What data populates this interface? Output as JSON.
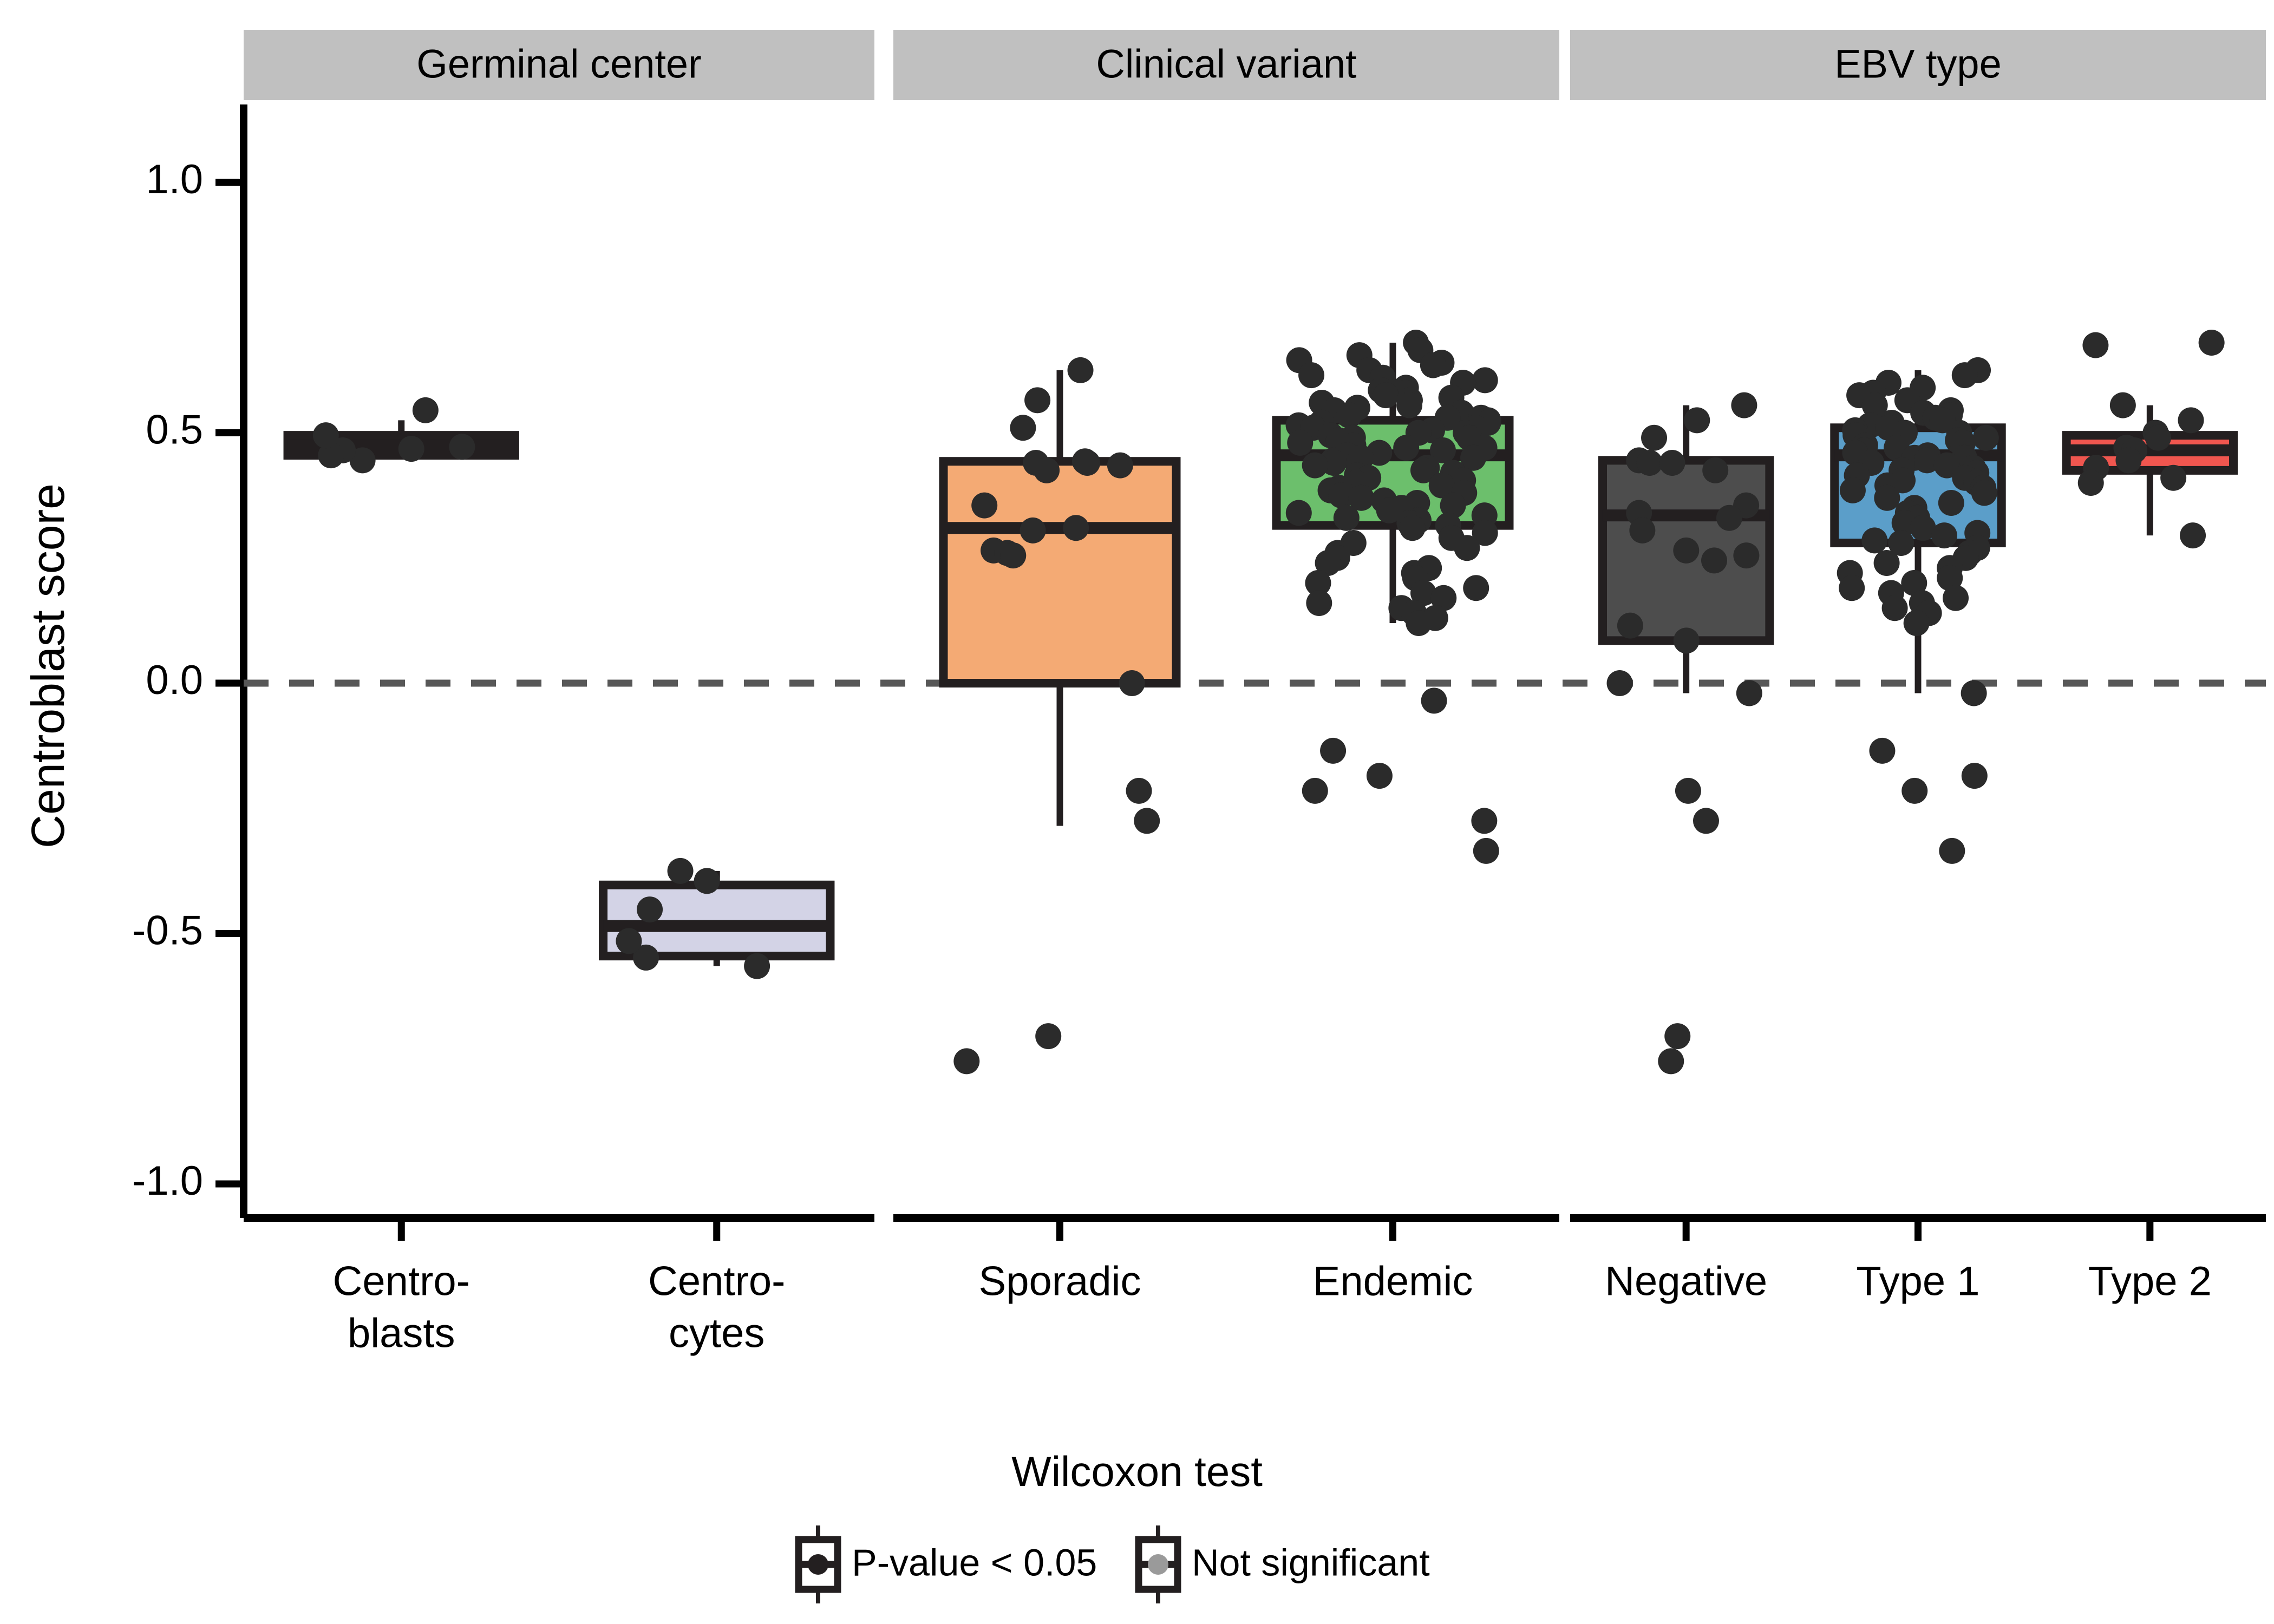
{
  "figure": {
    "ylabel": "Centroblast score",
    "y_ticks": [
      "1.0",
      "0.5",
      "0.0",
      "-0.5",
      "-1.0"
    ],
    "panels": [
      {
        "title": "Germinal center",
        "categories": [
          "Centro-\nblasts",
          "Centro-\ncytes"
        ]
      },
      {
        "title": "Clinical variant",
        "categories": [
          "Sporadic",
          "Endemic"
        ]
      },
      {
        "title": "EBV type",
        "categories": [
          "Negative",
          "Type 1",
          "Type 2"
        ]
      }
    ]
  },
  "legend": {
    "title": "Wilcoxon test",
    "items": [
      {
        "label": "P-value < 0.05",
        "box_fill": "#ffffff",
        "box_stroke": "#231f20",
        "dot": "#231f20"
      },
      {
        "label": "Not significant",
        "box_fill": "#ffffff",
        "box_stroke": "#231f20",
        "dot": "#9a9a9a"
      }
    ]
  },
  "colors": {
    "strip_bg": "#c0c0c0",
    "axis": "#000000",
    "point": "#2b2b2b",
    "zero_line": "#575757",
    "centroblasts": "#9a93c7",
    "centrocytes": "#d3d3e6",
    "sporadic": "#f4aa74",
    "endemic": "#6cbf6c",
    "negative": "#4d4d4d",
    "type1": "#5b9ec9",
    "type2": "#f0564f"
  },
  "chart_data": {
    "type": "box",
    "title": "",
    "ylabel": "Centroblast score",
    "xlabel": "",
    "ylim": [
      -1.18,
      1.12
    ],
    "yticks": [
      1.0,
      0.5,
      0.0,
      -0.5,
      -1.0
    ],
    "grid": false,
    "zero_reference_line": 0.0,
    "legend_position": "bottom",
    "facets": [
      {
        "name": "Germinal center",
        "groups": [
          {
            "label": "Centro-\nblasts",
            "fill": "#9a93c7",
            "significance": "P-value < 0.05",
            "box": {
              "q1": 0.455,
              "median": 0.475,
              "q3": 0.495,
              "lower_whisker": 0.455,
              "upper_whisker": 0.525
            },
            "points": [
              0.445,
              0.465,
              0.455,
              0.545,
              0.495,
              0.472,
              0.468
            ]
          },
          {
            "label": "Centro-\ncytes",
            "fill": "#d3d3e6",
            "significance": "P-value < 0.05",
            "box": {
              "q1": -0.545,
              "median": -0.485,
              "q3": -0.403,
              "lower_whisker": -0.565,
              "upper_whisker": -0.375
            },
            "points": [
              -0.375,
              -0.395,
              -0.452,
              -0.548,
              -0.565,
              -0.515
            ]
          }
        ]
      },
      {
        "name": "Clinical variant",
        "groups": [
          {
            "label": "Sporadic",
            "fill": "#f4aa74",
            "significance": "P-value < 0.05",
            "box": {
              "q1": 0.0,
              "median": 0.31,
              "q3": 0.443,
              "lower_whisker": -0.285,
              "upper_whisker": 0.625
            },
            "points": [
              0.625,
              0.565,
              0.51,
              0.443,
              0.435,
              0.44,
              0.44,
              0.425,
              0.355,
              0.31,
              0.305,
              0.265,
              0.26,
              0.255,
              0.0,
              -0.215,
              -0.275,
              -0.705,
              -0.755
            ]
          },
          {
            "label": "Endemic",
            "fill": "#6cbf6c",
            "significance": "P-value < 0.05",
            "box": {
              "q1": 0.315,
              "median": 0.455,
              "q3": 0.525,
              "lower_whisker": 0.12,
              "upper_whisker": 0.68
            },
            "points": [
              0.68,
              0.665,
              0.655,
              0.645,
              0.64,
              0.635,
              0.625,
              0.615,
              0.61,
              0.605,
              0.6,
              0.59,
              0.585,
              0.58,
              0.575,
              0.57,
              0.565,
              0.56,
              0.555,
              0.55,
              0.545,
              0.54,
              0.535,
              0.53,
              0.53,
              0.525,
              0.52,
              0.52,
              0.515,
              0.51,
              0.51,
              0.505,
              0.5,
              0.5,
              0.495,
              0.49,
              0.49,
              0.485,
              0.48,
              0.475,
              0.47,
              0.47,
              0.465,
              0.46,
              0.455,
              0.45,
              0.45,
              0.445,
              0.44,
              0.435,
              0.43,
              0.425,
              0.42,
              0.415,
              0.41,
              0.405,
              0.4,
              0.395,
              0.39,
              0.385,
              0.38,
              0.375,
              0.37,
              0.365,
              0.36,
              0.355,
              0.35,
              0.345,
              0.34,
              0.335,
              0.33,
              0.325,
              0.32,
              0.315,
              0.31,
              0.3,
              0.29,
              0.28,
              0.27,
              0.26,
              0.25,
              0.24,
              0.23,
              0.22,
              0.21,
              0.2,
              0.19,
              0.18,
              0.17,
              0.16,
              0.15,
              0.14,
              0.13,
              0.12,
              -0.035,
              -0.135,
              -0.185,
              -0.215,
              -0.275,
              -0.335
            ]
          }
        ]
      },
      {
        "name": "EBV type",
        "groups": [
          {
            "label": "Negative",
            "fill": "#4d4d4d",
            "significance": "P-value < 0.05",
            "box": {
              "q1": 0.085,
              "median": 0.335,
              "q3": 0.445,
              "lower_whisker": -0.02,
              "upper_whisker": 0.555
            },
            "points": [
              0.555,
              0.525,
              0.49,
              0.445,
              0.44,
              0.44,
              0.425,
              0.355,
              0.34,
              0.33,
              0.305,
              0.265,
              0.255,
              0.245,
              0.115,
              0.085,
              0.0,
              -0.02,
              -0.215,
              -0.275,
              -0.705,
              -0.755
            ]
          },
          {
            "label": "Type 1",
            "fill": "#5b9ec9",
            "significance": "P-value < 0.05",
            "box": {
              "q1": 0.28,
              "median": 0.455,
              "q3": 0.51,
              "lower_whisker": -0.02,
              "upper_whisker": 0.625
            },
            "points": [
              0.625,
              0.615,
              0.6,
              0.59,
              0.58,
              0.575,
              0.565,
              0.555,
              0.545,
              0.54,
              0.535,
              0.53,
              0.525,
              0.52,
              0.515,
              0.51,
              0.505,
              0.5,
              0.5,
              0.495,
              0.49,
              0.485,
              0.48,
              0.475,
              0.47,
              0.465,
              0.46,
              0.455,
              0.45,
              0.45,
              0.445,
              0.44,
              0.435,
              0.43,
              0.425,
              0.42,
              0.415,
              0.41,
              0.405,
              0.4,
              0.395,
              0.39,
              0.385,
              0.38,
              0.37,
              0.36,
              0.35,
              0.34,
              0.33,
              0.32,
              0.31,
              0.3,
              0.295,
              0.285,
              0.28,
              0.27,
              0.26,
              0.25,
              0.24,
              0.23,
              0.22,
              0.21,
              0.2,
              0.19,
              0.18,
              0.17,
              0.16,
              0.15,
              0.14,
              0.12,
              -0.02,
              -0.135,
              -0.185,
              -0.215,
              -0.335
            ]
          },
          {
            "label": "Type 2",
            "fill": "#f0564f",
            "significance": "P-value < 0.05",
            "box": {
              "q1": 0.425,
              "median": 0.465,
              "q3": 0.495,
              "lower_whisker": 0.295,
              "upper_whisker": 0.555
            },
            "points": [
              0.68,
              0.675,
              0.555,
              0.525,
              0.5,
              0.49,
              0.47,
              0.465,
              0.445,
              0.43,
              0.41,
              0.4,
              0.295
            ]
          }
        ]
      }
    ]
  }
}
